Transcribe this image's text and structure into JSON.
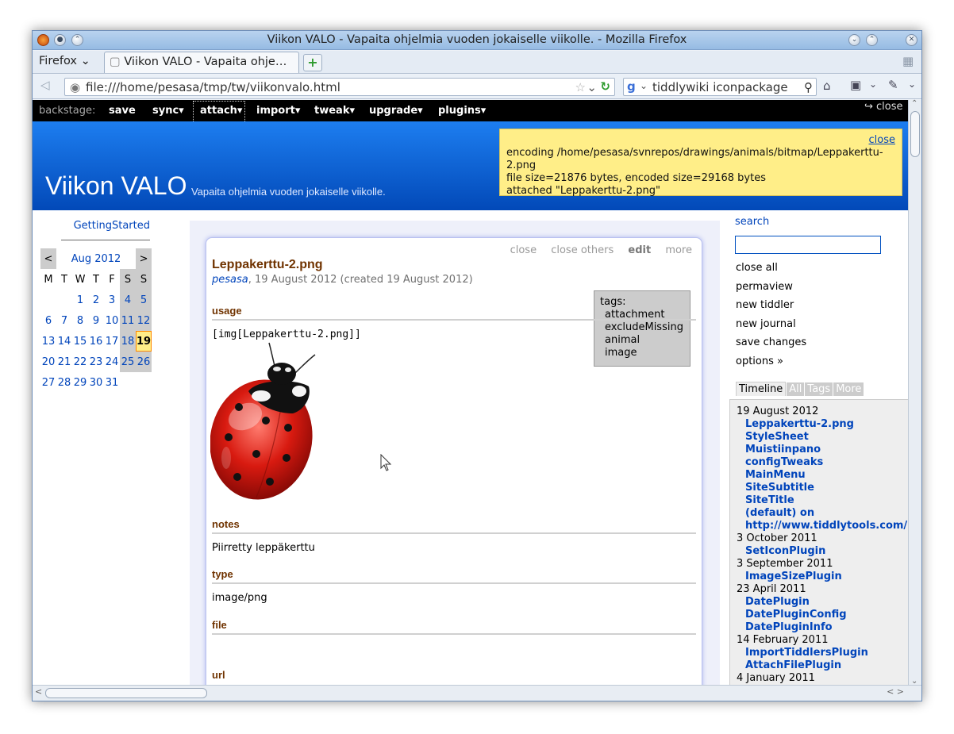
{
  "window": {
    "title": "Viikon VALO - Vapaita ohjelmia vuoden jokaiselle viikolle. - Mozilla Firefox"
  },
  "browser": {
    "app_menu": "Firefox",
    "tab_title": "Viikon VALO - Vapaita ohje…",
    "new_tab": "+",
    "url": "file:///home/pesasa/tmp/tw/viikonvalo.html",
    "search_value": "tiddlywiki iconpackage"
  },
  "backstage": {
    "label": "backstage:",
    "items": [
      "save",
      "sync▾",
      "attach▾",
      "import▾",
      "tweak▾",
      "upgrade▾",
      "plugins▾"
    ],
    "close": "↪ close"
  },
  "header": {
    "site_title": "Viikon VALO",
    "site_subtitle": "Vapaita ohjelmia vuoden jokaiselle viikolle."
  },
  "message": {
    "close": "close",
    "lines": [
      "encoding /home/pesasa/svnrepos/drawings/animals/bitmap/Leppakerttu-2.png",
      "file size=21876 bytes, encoded size=29168 bytes",
      "attached \"Leppakerttu-2.png\""
    ]
  },
  "main_menu": {
    "getting_started": "GettingStarted",
    "calendar": {
      "prev": "<",
      "month": "Aug 2012",
      "next": ">",
      "weekdays": [
        "M",
        "T",
        "W",
        "T",
        "F",
        "S",
        "S"
      ],
      "weeks": [
        [
          "",
          "",
          "1",
          "2",
          "3",
          "4",
          "5"
        ],
        [
          "6",
          "7",
          "8",
          "9",
          "10",
          "11",
          "12"
        ],
        [
          "13",
          "14",
          "15",
          "16",
          "17",
          "18",
          "19"
        ],
        [
          "20",
          "21",
          "22",
          "23",
          "24",
          "25",
          "26"
        ],
        [
          "27",
          "28",
          "29",
          "30",
          "31",
          "",
          ""
        ]
      ],
      "today": "19"
    }
  },
  "tiddler": {
    "toolbar": [
      "close",
      "close others",
      "edit",
      "more"
    ],
    "title": "Leppakerttu-2.png",
    "modifier": "pesasa",
    "subtitle_rest": ", 19 August 2012 (created 19 August 2012)",
    "tags_label": "tags:",
    "tags": [
      "attachment",
      "excludeMissing",
      "animal",
      "image"
    ],
    "sections": {
      "usage": {
        "heading": "usage",
        "value": "[img[Leppakerttu-2.png]]"
      },
      "notes": {
        "heading": "notes",
        "value": "Piirretty leppäkerttu"
      },
      "type": {
        "heading": "type",
        "value": "image/png"
      },
      "file": {
        "heading": "file",
        "value": ""
      },
      "url": {
        "heading": "url",
        "value": ""
      }
    }
  },
  "sidebar": {
    "search_label": "search",
    "search_value": "",
    "options": [
      "close all",
      "permaview",
      "new tiddler",
      "new journal",
      "save changes",
      "options »"
    ],
    "tabs": [
      "Timeline",
      "All",
      "Tags",
      "More"
    ],
    "timeline": [
      {
        "date": "19 August 2012",
        "items": [
          "Leppakerttu-2.png",
          "StyleSheet",
          "Muistiinpano",
          "configTweaks",
          "MainMenu",
          "SiteSubtitle",
          "SiteTitle",
          "(default) on",
          "http://www.tiddlytools.com/"
        ]
      },
      {
        "date": "3 October 2011",
        "items": [
          "SetIconPlugin"
        ]
      },
      {
        "date": "3 September 2011",
        "items": [
          "ImageSizePlugin"
        ]
      },
      {
        "date": "23 April 2011",
        "items": [
          "DatePlugin",
          "DatePluginConfig",
          "DatePluginInfo"
        ]
      },
      {
        "date": "14 February 2011",
        "items": [
          "ImportTiddlersPlugin",
          "AttachFilePlugin"
        ]
      },
      {
        "date": "4 January 2011",
        "items": []
      }
    ]
  },
  "colors": {
    "header": "#0249b8",
    "accent_link": "#0044bb",
    "message_bg": "#ffee88",
    "today": "#ffee88"
  }
}
